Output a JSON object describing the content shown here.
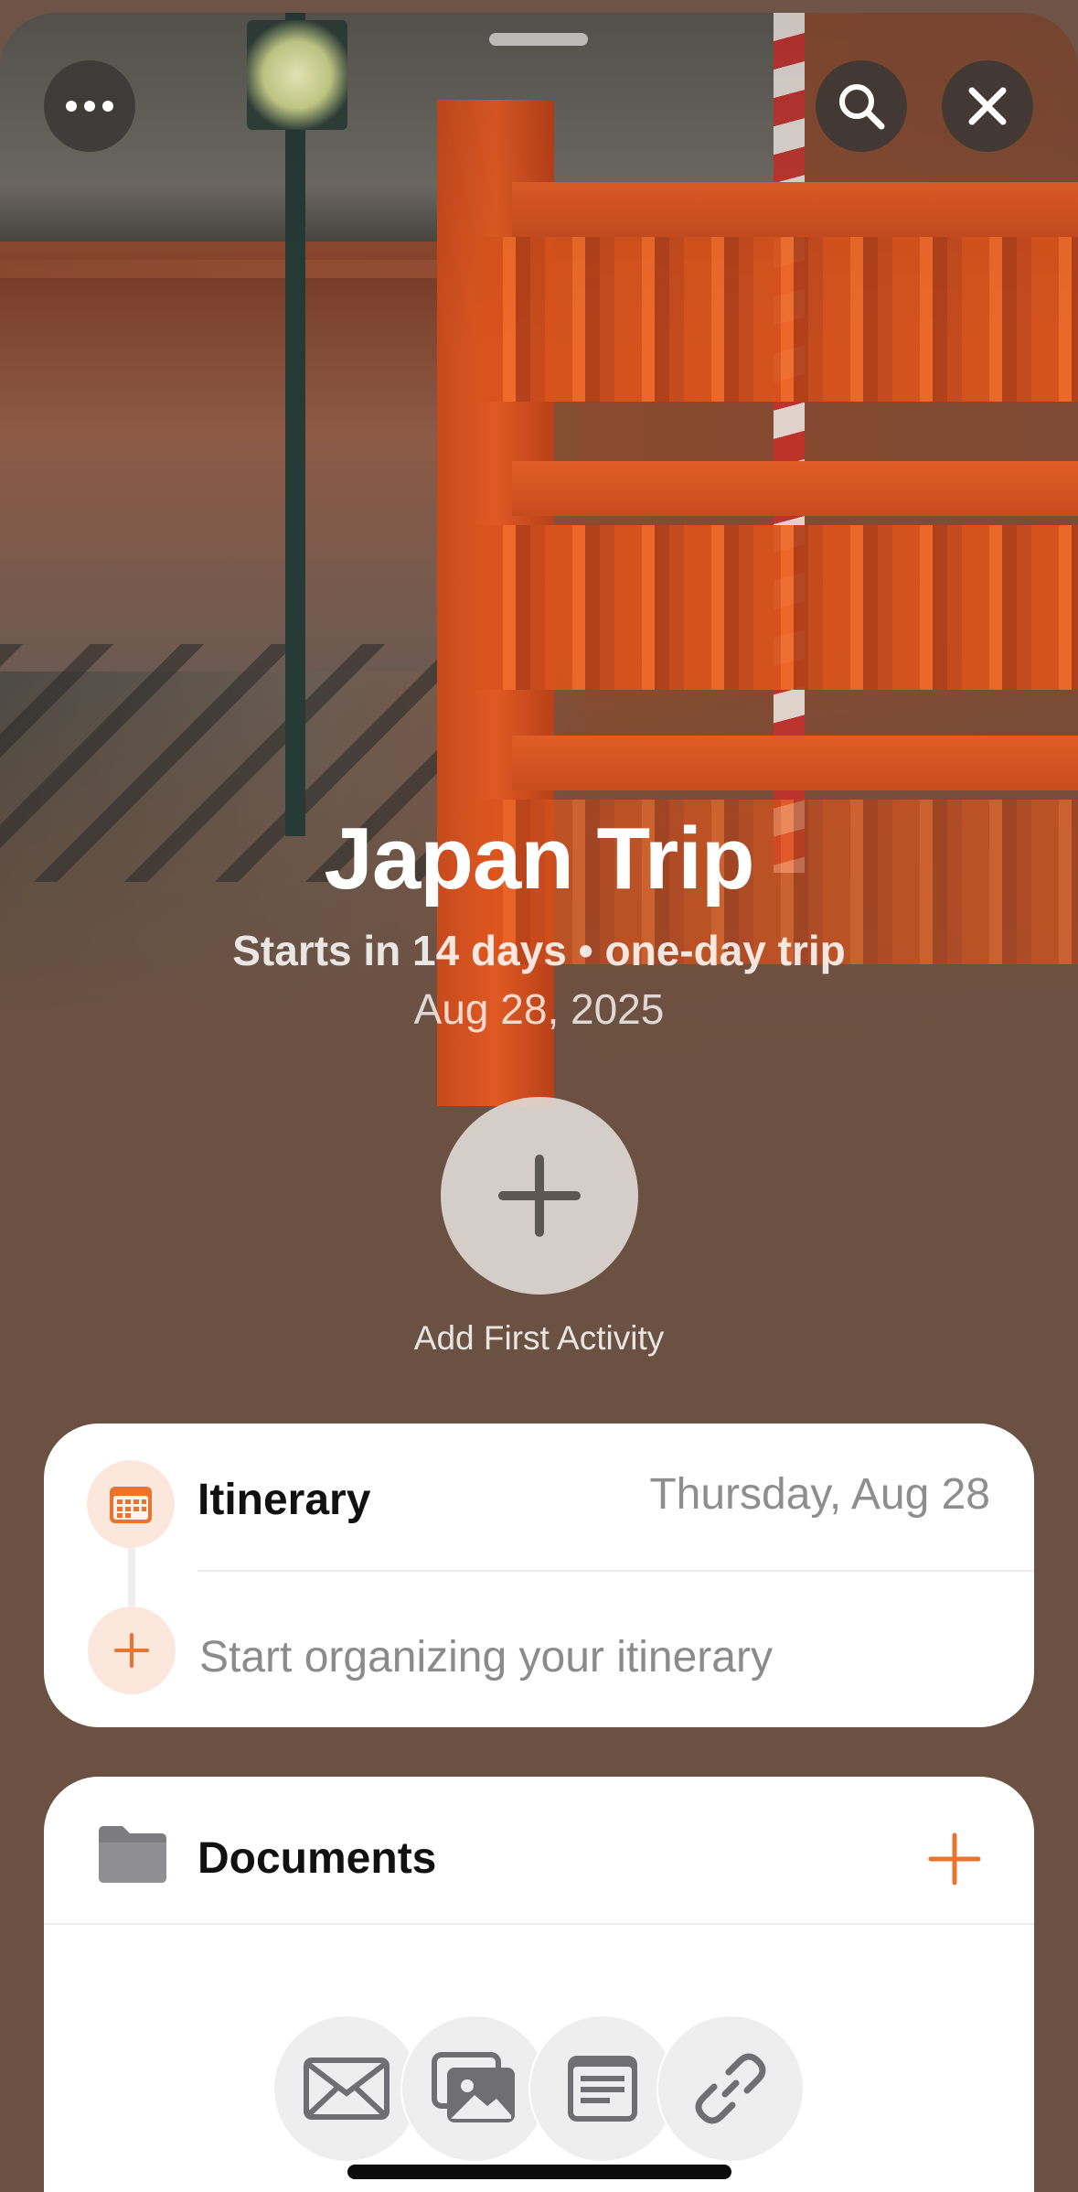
{
  "trip": {
    "title": "Japan Trip",
    "subtitle": "Starts in 14 days • one-day trip",
    "date": "Aug 28, 2025"
  },
  "toolbar": {
    "more_icon": "ellipsis-icon",
    "search_icon": "search-icon",
    "close_icon": "close-icon"
  },
  "add_activity": {
    "label": "Add First Activity",
    "icon": "plus-icon"
  },
  "itinerary": {
    "title": "Itinerary",
    "day": "Thursday, Aug 28",
    "placeholder": "Start organizing your itinerary",
    "icon": "calendar-icon"
  },
  "documents": {
    "title": "Documents",
    "icon": "folder-icon",
    "add_icon": "plus-icon",
    "sources": [
      "mail-icon",
      "photos-icon",
      "note-icon",
      "link-icon"
    ]
  },
  "colors": {
    "accent": "#E8742F",
    "sheet_background": "#6B5142"
  }
}
